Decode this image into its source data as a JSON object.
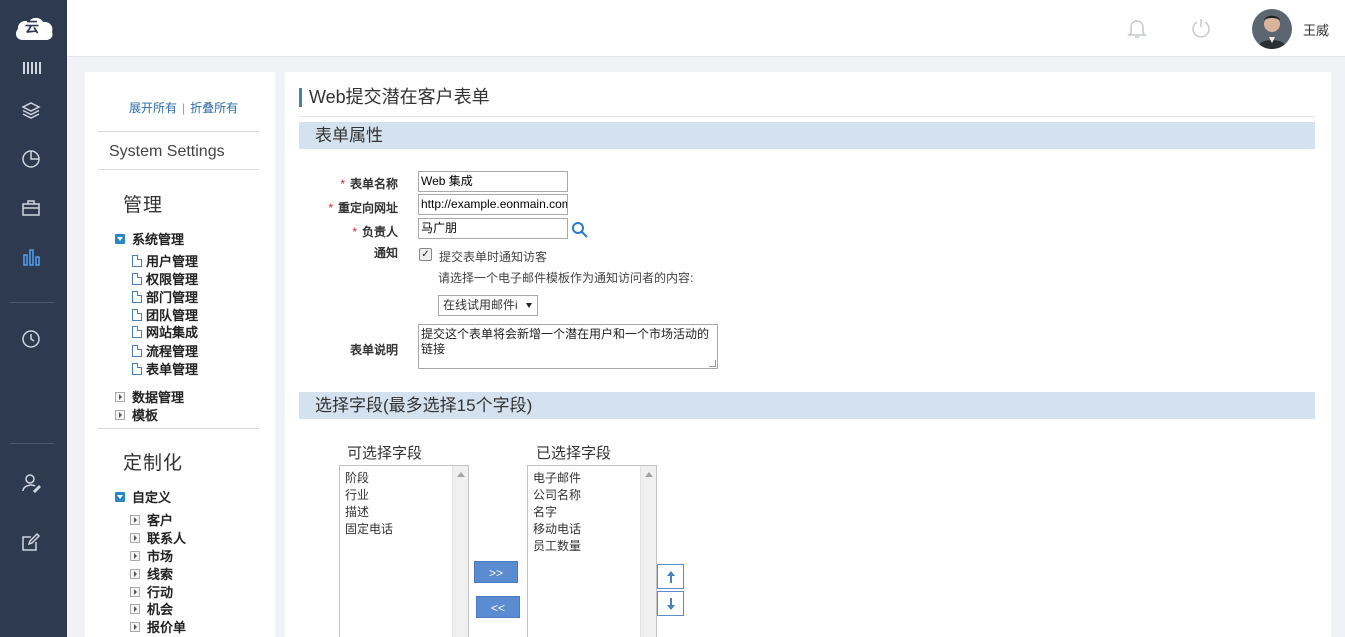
{
  "header": {
    "logo_text": "云",
    "username": "王威",
    "icons": [
      "bell-icon",
      "power-icon"
    ]
  },
  "rail": {
    "icons": [
      "barcode-icon",
      "layers-icon",
      "pie-chart-icon",
      "briefcase-icon",
      "bar-chart-icon",
      "clock-icon",
      "user-edit-icon",
      "edit-icon"
    ]
  },
  "tree": {
    "expand_all": "展开所有",
    "separator": "|",
    "collapse_all": "折叠所有",
    "system_settings": "System Settings",
    "section_manage": "管理",
    "section_custom": "定制化",
    "system_manage": "系统管理",
    "system_items": [
      "用户管理",
      "权限管理",
      "部门管理",
      "团队管理",
      "网站集成",
      "流程管理",
      "表单管理"
    ],
    "data_manage": "数据管理",
    "templates": "模板",
    "custom_root": "自定义",
    "custom_items": [
      "客户",
      "联系人",
      "市场",
      "线索",
      "行动",
      "机会",
      "报价单"
    ]
  },
  "main": {
    "title": "Web提交潜在客户表单",
    "band_props": "表单属性",
    "required_mark": "*",
    "label_form_name": "表单名称",
    "label_redirect": "重定向网址",
    "label_owner": "负责人",
    "label_notify": "通知",
    "label_desc": "表单说明",
    "form_name_value": "Web 集成",
    "redirect_value": "http://example.eonmain.com",
    "owner_value": "马广朋",
    "notify_checkbox_label": "提交表单时通知访客",
    "notify_checked": true,
    "notify_hint": "请选择一个电子邮件模板作为通知访问者的内容:",
    "template_selected": "在线试用邮件i",
    "description_value": "提交这个表单将会新增一个潜在用户和一个市场活动的链接",
    "band_fields": "选择字段(最多选择15个字段)",
    "available_title": "可选择字段",
    "selected_title": "已选择字段",
    "available_fields": [
      "阶段",
      "行业",
      "描述",
      "固定电话"
    ],
    "selected_fields": [
      "电子邮件",
      "公司名称",
      "名字",
      "移动电话",
      "员工数量"
    ],
    "add_button": ">>",
    "remove_button": "<<"
  }
}
